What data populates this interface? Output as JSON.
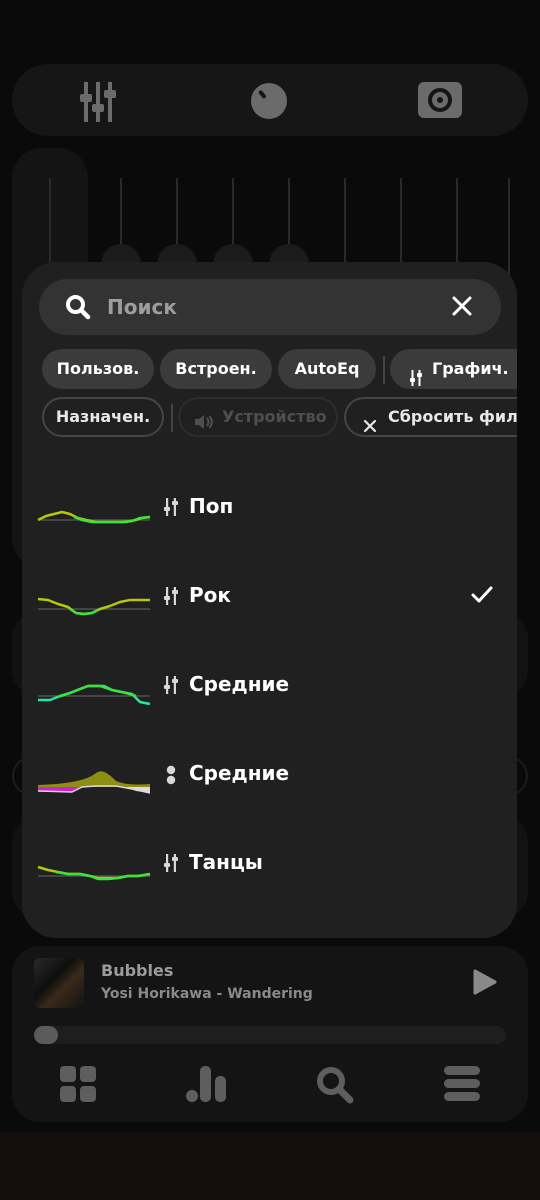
{
  "search": {
    "placeholder": "Поиск"
  },
  "filters": {
    "row1": [
      {
        "label": "Пользов."
      },
      {
        "label": "Встроен."
      },
      {
        "label": "AutoEq"
      },
      {
        "label": "Графич."
      }
    ],
    "row2": [
      {
        "label": "Назначен."
      },
      {
        "label": "Устройство"
      },
      {
        "label": "Сбросить филь"
      }
    ]
  },
  "presets": [
    {
      "name": "Поп",
      "type": "graphic-eq-icon",
      "selected": false
    },
    {
      "name": "Рок",
      "type": "graphic-eq-icon",
      "selected": true
    },
    {
      "name": "Средние",
      "type": "graphic-eq-icon",
      "selected": false
    },
    {
      "name": "Средние",
      "type": "parametric-eq-icon",
      "selected": false
    },
    {
      "name": "Танцы",
      "type": "graphic-eq-icon",
      "selected": false
    }
  ],
  "player": {
    "title": "Bubbles",
    "artist": "Yosi Horikawa - Wandering",
    "progress": 0.05
  },
  "colors": {
    "curve_green": "#3ee23e",
    "curve_yellow": "#b5c80a",
    "curve_teal": "#20e8a0",
    "accent_magenta": "#d020d0"
  }
}
